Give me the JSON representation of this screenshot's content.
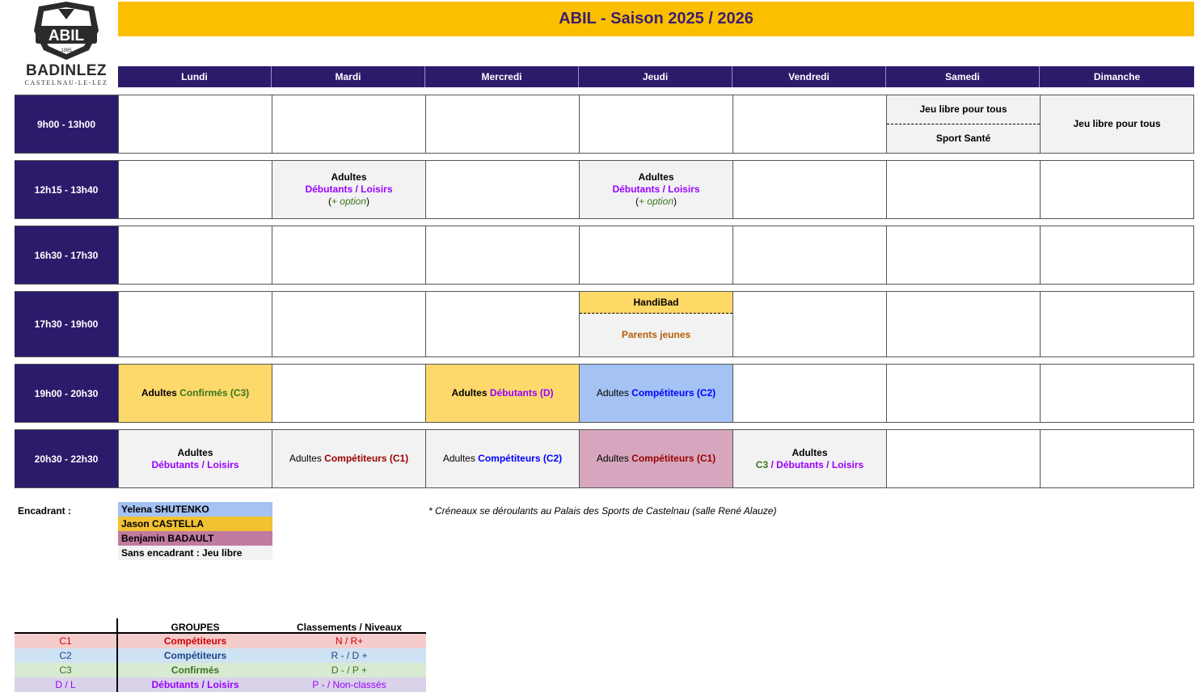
{
  "logo": {
    "badge_text": "ABIL",
    "badge_year": "1995",
    "brand": "BADINLEZ",
    "town": "CASTELNAU-LE-LEZ"
  },
  "title": "ABIL - Saison 2025 / 2026",
  "days": [
    "Lundi",
    "Mardi",
    "Mercredi",
    "Jeudi",
    "Vendredi",
    "Samedi",
    "Dimanche"
  ],
  "slots": [
    {
      "time": "9h00 - 13h00",
      "samedi_top": "Jeu libre pour tous",
      "samedi_bottom": "Sport Santé",
      "dimanche": "Jeu libre pour tous"
    },
    {
      "time": "12h15 - 13h40",
      "mardi": {
        "line1": "Adultes",
        "line2a": "Débutants",
        "line2sep": " / ",
        "line2b": "Loisirs",
        "open": "(",
        "opt": "+ option",
        "close": ")"
      },
      "jeudi": {
        "line1": "Adultes",
        "line2a": "Débutants",
        "line2sep": " / ",
        "line2b": "Loisirs",
        "open": "(",
        "opt": "+ option",
        "close": ")"
      }
    },
    {
      "time": "16h30 - 17h30"
    },
    {
      "time": "17h30 - 19h00",
      "jeudi_top": "HandiBad",
      "jeudi_bottom": "Parents jeunes"
    },
    {
      "time": "19h00 - 20h30",
      "lundi": {
        "a": "Adultes ",
        "b": "Confirmés (C3)"
      },
      "mercredi": {
        "a": "Adultes ",
        "b": "Débutants (D)"
      },
      "jeudi": {
        "a": "Adultes ",
        "b": "Compétiteurs (C2)"
      }
    },
    {
      "time": "20h30 - 22h30",
      "lundi": {
        "line1": "Adultes",
        "a": "Débutants",
        "sep": " / ",
        "b": "Loisirs"
      },
      "mardi": {
        "a": "Adultes ",
        "b": "Compétiteurs (C1)"
      },
      "mercredi": {
        "a": "Adultes ",
        "b": "Compétiteurs (C2)"
      },
      "jeudi": {
        "a": "Adultes ",
        "b": "Compétiteurs (C1)"
      },
      "vendredi": {
        "line1": "Adultes",
        "c3": "C3",
        "sep1": " / ",
        "a": "Débutants",
        "sep2": " / ",
        "b": "Loisirs"
      }
    }
  ],
  "encadrant": {
    "label": "Encadrant :",
    "list": [
      {
        "name": "Yelena SHUTENKO",
        "color": "#a4c2f4"
      },
      {
        "name": "Jason CASTELLA",
        "color": "#f1c232"
      },
      {
        "name": "Benjamin BADAULT",
        "color": "#c27ba0"
      },
      {
        "name": "Sans encadrant : Jeu libre",
        "color": "#f2f2f2"
      }
    ]
  },
  "note": "* Créneaux se déroulants au Palais des Sports de Castelnau (salle René Alauze)",
  "legend": {
    "headers": [
      "",
      "GROUPES",
      "Classements / Niveaux"
    ],
    "rows": [
      {
        "code": "C1",
        "group": "Compétiteurs",
        "level": "N / R+",
        "bg": "#f4cccc",
        "color": "#cc0000"
      },
      {
        "code": "C2",
        "group": "Compétiteurs",
        "level": "R - / D +",
        "bg": "#cfe2f3",
        "color": "#1c4587"
      },
      {
        "code": "C3",
        "group": "Confirmés",
        "level": "D - / P +",
        "bg": "#d9ead3",
        "color": "#38761d"
      },
      {
        "code": "D / L",
        "group": "Débutants / Loisirs",
        "level": "P - / Non-classés",
        "bg": "#d9d2e9",
        "color": "#9900ff"
      }
    ]
  }
}
